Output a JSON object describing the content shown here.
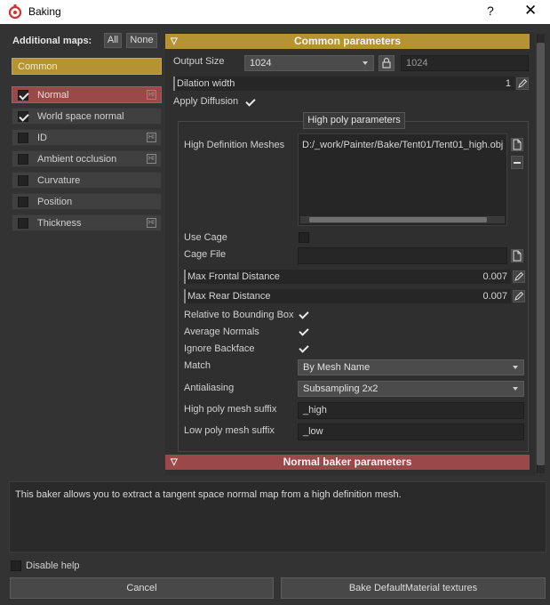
{
  "window": {
    "title": "Baking",
    "help_label": "?",
    "close_label": "✕"
  },
  "left": {
    "additional_maps_label": "Additional maps:",
    "all_label": "All",
    "none_label": "None",
    "common_label": "Common",
    "maps": [
      {
        "label": "Normal",
        "checked": true,
        "hi": true,
        "active": true
      },
      {
        "label": "World space normal",
        "checked": true,
        "hi": false,
        "active": false
      },
      {
        "label": "ID",
        "checked": false,
        "hi": true,
        "active": false
      },
      {
        "label": "Ambient occlusion",
        "checked": false,
        "hi": true,
        "active": false
      },
      {
        "label": "Curvature",
        "checked": false,
        "hi": false,
        "active": false
      },
      {
        "label": "Position",
        "checked": false,
        "hi": false,
        "active": false
      },
      {
        "label": "Thickness",
        "checked": false,
        "hi": true,
        "active": false
      }
    ],
    "hi_label": "HI"
  },
  "common": {
    "header": "Common parameters",
    "output_size_label": "Output Size",
    "output_size_value": "1024",
    "output_size_linked_value": "1024",
    "dilation_label": "Dilation width",
    "dilation_value": "1",
    "apply_diffusion_label": "Apply Diffusion"
  },
  "highpoly": {
    "header": "High poly parameters",
    "meshes_label": "High Definition Meshes",
    "mesh_path": "D:/_work/Painter/Bake/Tent01/Tent01_high.obj",
    "use_cage_label": "Use Cage",
    "cage_file_label": "Cage File",
    "cage_file_value": "",
    "max_frontal_label": "Max Frontal Distance",
    "max_frontal_value": "0.007",
    "max_rear_label": "Max Rear Distance",
    "max_rear_value": "0.007",
    "relative_bbox_label": "Relative to Bounding Box",
    "average_normals_label": "Average Normals",
    "ignore_backface_label": "Ignore Backface",
    "match_label": "Match",
    "match_value": "By Mesh Name",
    "antialiasing_label": "Antialiasing",
    "antialiasing_value": "Subsampling 2x2",
    "high_suffix_label": "High poly mesh suffix",
    "high_suffix_value": "_high",
    "low_suffix_label": "Low poly mesh suffix",
    "low_suffix_value": "_low"
  },
  "normal_baker": {
    "header": "Normal baker parameters"
  },
  "description": "This baker allows you to extract a tangent space normal map from a high definition mesh.",
  "footer": {
    "disable_help_label": "Disable help",
    "cancel_label": "Cancel",
    "bake_label": "Bake DefaultMaterial textures"
  },
  "colors": {
    "accent_common": "#b59232",
    "accent_normal": "#9b4848",
    "background": "#333333"
  }
}
